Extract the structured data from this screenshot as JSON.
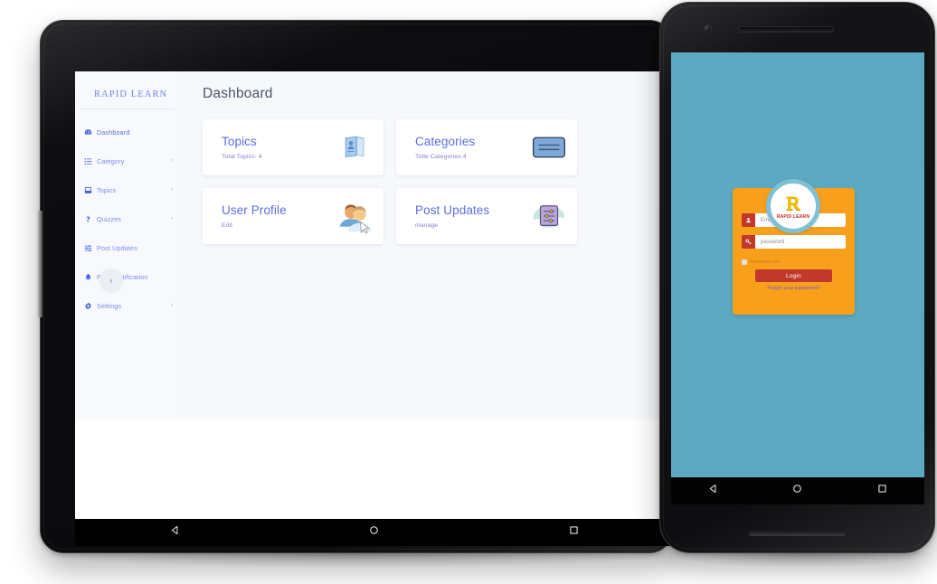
{
  "tablet": {
    "app": {
      "brand": "RAPID LEARN",
      "sidebar": {
        "collapse_label": "‹",
        "items": [
          {
            "label": "Dashboard",
            "icon": "tachometer-icon",
            "caret": "",
            "active": true
          },
          {
            "label": "Category",
            "icon": "list-icon",
            "caret": "›",
            "active": false
          },
          {
            "label": "Topics",
            "icon": "book-icon",
            "caret": "›",
            "active": false
          },
          {
            "label": "Quizzes",
            "icon": "question-icon",
            "caret": "›",
            "active": false
          },
          {
            "label": "Post Updates",
            "icon": "sliders-icon",
            "caret": "",
            "active": false
          },
          {
            "label": "Push Notification",
            "icon": "bell-icon",
            "caret": "",
            "active": false
          },
          {
            "label": "Settings",
            "icon": "gear-icon",
            "caret": "›",
            "active": false
          }
        ]
      },
      "page_title": "Dashboard",
      "cards": [
        {
          "title": "Topics",
          "subtitle": "Total Topics: 4",
          "icon": "brochure-icon"
        },
        {
          "title": "Categories",
          "subtitle": "Totle Categories:4",
          "icon": "card-stack-icon"
        },
        {
          "title": "User Profile",
          "subtitle": "Edit",
          "icon": "users-cursor-icon"
        },
        {
          "title": "Post Updates",
          "subtitle": "manage",
          "icon": "document-settings-icon"
        }
      ]
    },
    "navbar": {
      "back": "back-icon",
      "home": "home-icon",
      "recents": "recents-icon"
    }
  },
  "phone": {
    "screen_bg": "#5da9c2",
    "login": {
      "logo_letter": "R",
      "logo_word": "RAPID LEARN",
      "email_placeholder": "Email id",
      "password_placeholder": "password",
      "remember_label": "Remember me",
      "login_button": "Login",
      "forgot_link": "Forgot your password?"
    },
    "navbar": {
      "back": "back-icon",
      "home": "home-icon",
      "recents": "recents-icon"
    }
  },
  "colors": {
    "brand_blue": "#6a85e8",
    "card_title": "#5a6fe0",
    "phone_bg": "#5da9c2",
    "login_card": "#f8a01c",
    "login_button": "#c0392b"
  }
}
